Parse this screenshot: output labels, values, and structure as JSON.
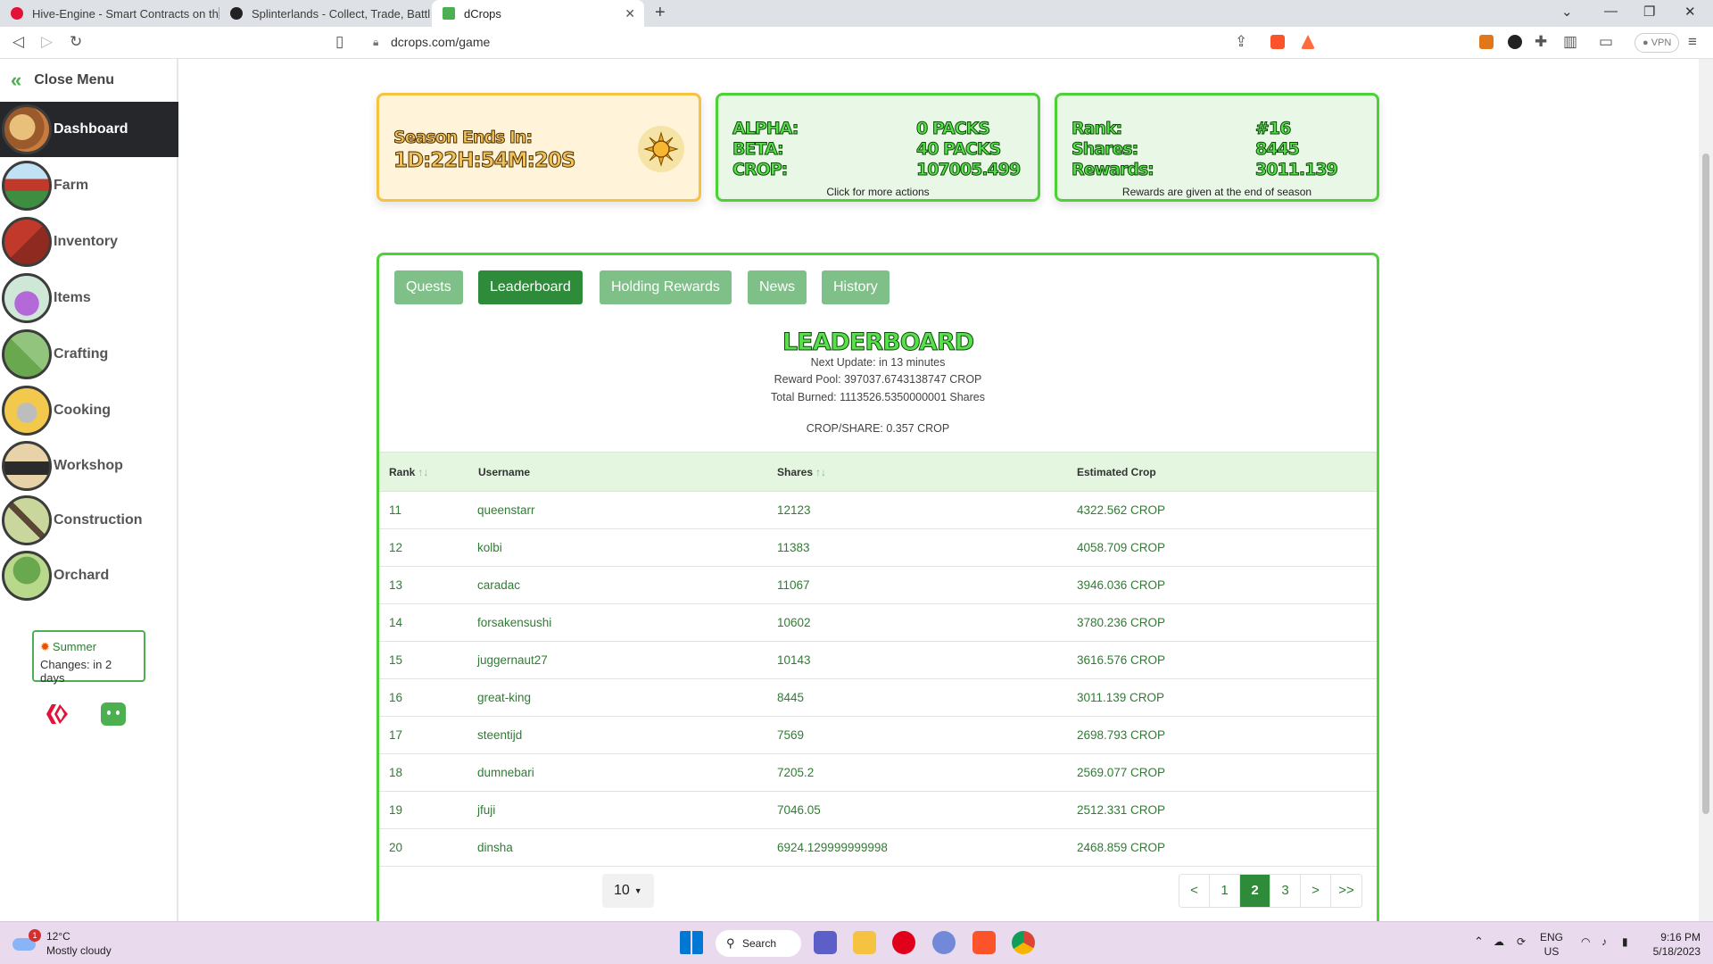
{
  "browser": {
    "tabs": [
      {
        "title": "Hive-Engine - Smart Contracts on the",
        "color": "#e31337"
      },
      {
        "title": "Splinterlands - Collect, Trade, Battle!",
        "color": "#222222"
      },
      {
        "title": "dCrops",
        "color": "#4caf50",
        "close": "✕"
      }
    ],
    "url": "dcrops.com/game",
    "vpn_label": "VPN"
  },
  "sidebar": {
    "close_label": "Close Menu",
    "items": [
      {
        "label": "Dashboard"
      },
      {
        "label": "Farm"
      },
      {
        "label": "Inventory"
      },
      {
        "label": "Items"
      },
      {
        "label": "Crafting"
      },
      {
        "label": "Cooking"
      },
      {
        "label": "Workshop"
      },
      {
        "label": "Construction"
      },
      {
        "label": "Orchard"
      }
    ],
    "season": {
      "name": "Summer",
      "changes": "Changes: in 2 days"
    }
  },
  "cards": {
    "season": {
      "label": "Season Ends In:",
      "value": "1D:22H:54M:20S"
    },
    "packs": {
      "rows": [
        {
          "k": "ALPHA:",
          "v": "0 PACKS"
        },
        {
          "k": "BETA:",
          "v": "40 PACKS"
        },
        {
          "k": "CROP:",
          "v": "107005.499"
        }
      ],
      "caption": "Click for more actions"
    },
    "rank": {
      "rows": [
        {
          "k": "Rank:",
          "v": "#16"
        },
        {
          "k": "Shares:",
          "v": "8445"
        },
        {
          "k": "Rewards:",
          "v": "3011.139"
        }
      ],
      "caption": "Rewards are given at the end of season"
    }
  },
  "panel": {
    "tabs": [
      "Quests",
      "Leaderboard",
      "Holding Rewards",
      "News",
      "History"
    ],
    "active_tab": "Leaderboard",
    "title": "LEADERBOARD",
    "next_update": "Next Update: in 13 minutes",
    "reward_pool": "Reward Pool: 397037.6743138747 CROP",
    "total_burned": "Total Burned: 1113526.5350000001 Shares",
    "crop_per_share": "CROP/SHARE: 0.357 CROP",
    "columns": {
      "rank": "Rank",
      "username": "Username",
      "shares": "Shares",
      "estimated": "Estimated Crop",
      "sort_glyph": "↑↓"
    },
    "rows": [
      {
        "rank": "11",
        "username": "queenstarr",
        "shares": "12123",
        "est": "4322.562 CROP"
      },
      {
        "rank": "12",
        "username": "kolbi",
        "shares": "11383",
        "est": "4058.709 CROP"
      },
      {
        "rank": "13",
        "username": "caradac",
        "shares": "11067",
        "est": "3946.036 CROP"
      },
      {
        "rank": "14",
        "username": "forsakensushi",
        "shares": "10602",
        "est": "3780.236 CROP"
      },
      {
        "rank": "15",
        "username": "juggernaut27",
        "shares": "10143",
        "est": "3616.576 CROP"
      },
      {
        "rank": "16",
        "username": "great-king",
        "shares": "8445",
        "est": "3011.139 CROP"
      },
      {
        "rank": "17",
        "username": "steentijd",
        "shares": "7569",
        "est": "2698.793 CROP"
      },
      {
        "rank": "18",
        "username": "dumnebari",
        "shares": "7205.2",
        "est": "2569.077 CROP"
      },
      {
        "rank": "19",
        "username": "jfuji",
        "shares": "7046.05",
        "est": "2512.331 CROP"
      },
      {
        "rank": "20",
        "username": "dinsha",
        "shares": "6924.129999999998",
        "est": "2468.859 CROP"
      }
    ],
    "page_size": "10",
    "pager": [
      "<",
      "1",
      "2",
      "3",
      ">",
      ">>"
    ],
    "current_page": "2"
  },
  "taskbar": {
    "weather_temp": "12°C",
    "weather_desc": "Mostly cloudy",
    "weather_badge": "1",
    "search_label": "Search",
    "lang": "ENG",
    "region": "US",
    "time": "9:16 PM",
    "date": "5/18/2023"
  }
}
